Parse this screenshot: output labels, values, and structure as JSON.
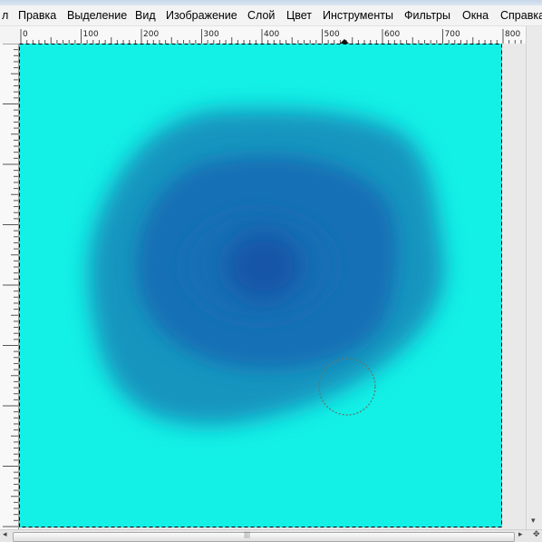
{
  "menu": {
    "items": [
      {
        "label": "л"
      },
      {
        "label": "Правка"
      },
      {
        "label": "Выделение"
      },
      {
        "label": "Вид"
      },
      {
        "label": "Изображение"
      },
      {
        "label": "Слой"
      },
      {
        "label": "Цвет"
      },
      {
        "label": "Инструменты"
      },
      {
        "label": "Фильтры"
      },
      {
        "label": "Окна"
      },
      {
        "label": "Справка"
      }
    ]
  },
  "ruler": {
    "labels": [
      "0",
      "100",
      "200",
      "300",
      "400",
      "500",
      "600",
      "700",
      "800"
    ]
  },
  "canvas": {
    "background_color": "#13f0e6",
    "blob_colors": [
      "#1495bf",
      "#136fb5",
      "#1255a8"
    ]
  }
}
